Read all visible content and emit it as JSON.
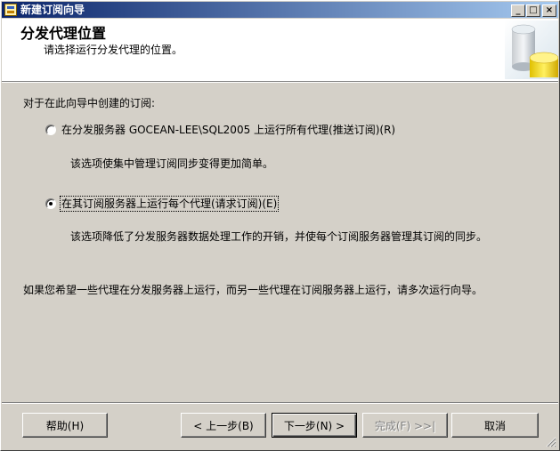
{
  "window": {
    "title": "新建订阅向导",
    "controls": {
      "minimize": "_",
      "maximize": "□",
      "close": "×"
    }
  },
  "header": {
    "title": "分发代理位置",
    "subtitle": "请选择运行分发代理的位置。"
  },
  "body": {
    "prompt": "对于在此向导中创建的订阅:",
    "options": [
      {
        "label": "在分发服务器 GOCEAN-LEE\\SQL2005 上运行所有代理(推送订阅)(R)",
        "description": "该选项使集中管理订阅同步变得更加简单。",
        "selected": false
      },
      {
        "label": "在其订阅服务器上运行每个代理(请求订阅)(E)",
        "description": "该选项降低了分发服务器数据处理工作的开销，并使每个订阅服务器管理其订阅的同步。",
        "selected": true
      }
    ],
    "note": "如果您希望一些代理在分发服务器上运行，而另一些代理在订阅服务器上运行，请多次运行向导。"
  },
  "buttons": {
    "help": "帮助(H)",
    "back": "< 上一步(B)",
    "next": "下一步(N) >",
    "finish": "完成(F) >>|",
    "cancel": "取消"
  },
  "icons": {
    "title_icon": "wizard-app-icon",
    "header_art": "database-cylinders-icon",
    "resize_grip": "resize-grip-icon"
  },
  "colors": {
    "titlebar_start": "#0a246a",
    "titlebar_end": "#a6caf0",
    "dialog_bg": "#d4d0c8",
    "header_bg": "#ffffff"
  }
}
